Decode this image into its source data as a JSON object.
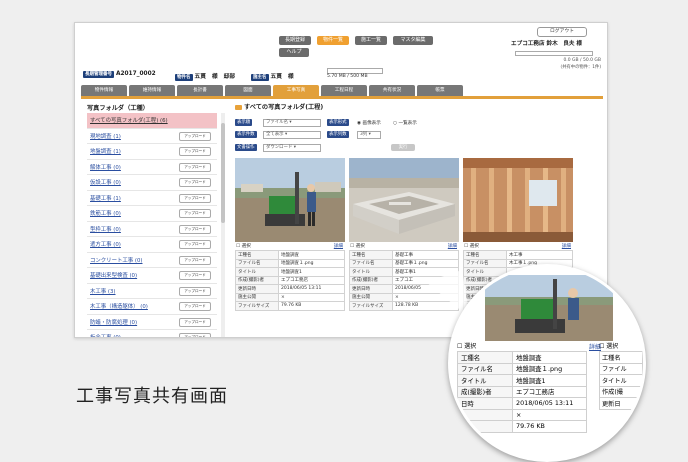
{
  "nav": {
    "buttons": [
      {
        "label": "長期登録"
      },
      {
        "label": "物件一覧"
      },
      {
        "label": "施工一覧"
      },
      {
        "label": "マスタ編集"
      },
      {
        "label": "ヘルプ"
      }
    ]
  },
  "account": {
    "logout_label": "ログアウト",
    "company_user": "エプコ工務店 鈴木　良夫 様",
    "usage": "0.0 GB / 50.0 GB",
    "usage_note": "(共有中の物件：1件)"
  },
  "project": {
    "id_tag": "長期管理番号",
    "id_value": "A2017_0002",
    "name_tag": "物件名",
    "name_value": "五貫　様　邸部",
    "owner_tag": "施主名",
    "owner_value": "五貫　様",
    "storage": "5.70 MB / 500 MB"
  },
  "tabs": [
    {
      "label": "物件情報"
    },
    {
      "label": "維持情報"
    },
    {
      "label": "長計書"
    },
    {
      "label": "図面"
    },
    {
      "label": "工事写真"
    },
    {
      "label": "工程日程"
    },
    {
      "label": "共有状況"
    },
    {
      "label": "帳票"
    }
  ],
  "sidebar": {
    "title": "写真フォルダ（工種）",
    "upload_label": "アップロード",
    "items": [
      {
        "label": "すべての写真フォルダ(工程) (6)"
      },
      {
        "label": "現地調査 (1)"
      },
      {
        "label": "地盤調査 (1)"
      },
      {
        "label": "解体工事 (0)"
      },
      {
        "label": "仮設工事 (0)"
      },
      {
        "label": "基礎工事 (1)"
      },
      {
        "label": "鉄筋工事 (0)"
      },
      {
        "label": "型枠工事 (0)"
      },
      {
        "label": "遣方工事 (0)"
      },
      {
        "label": "コンクリート工事 (0)"
      },
      {
        "label": "基礎出来型検査 (0)"
      },
      {
        "label": "木工事 (3)"
      },
      {
        "label": "木工事（構造躯体） (0)"
      },
      {
        "label": "防蟻・防腐処理 (0)"
      },
      {
        "label": "板金工事 (0)"
      }
    ]
  },
  "main": {
    "title": "すべての写真フォルダ(工程)",
    "display_item_label": "表示順",
    "display_item_value": "ファイル名",
    "display_format_label": "表示形式",
    "radio_image": "画像表示",
    "radio_list": "一覧表示",
    "display_count_label": "表示件数",
    "display_count_value": "全て表示",
    "columns_label": "表示列数",
    "columns_value": "3列",
    "doc_op_label": "文書操作",
    "doc_op_value": "ダウンロード",
    "run_label": "実行",
    "select_label": "選択",
    "detail_label": "詳細"
  },
  "photos": [
    {
      "rows": [
        {
          "k": "工種名",
          "v": "地盤調査"
        },
        {
          "k": "ファイル名",
          "v": "地盤調査１.png"
        },
        {
          "k": "タイトル",
          "v": "地盤調査1"
        },
        {
          "k": "作成(撮影)者",
          "v": "エプコ工務店"
        },
        {
          "k": "更新日時",
          "v": "2018/06/05 13:11"
        },
        {
          "k": "施主公開",
          "v": "×"
        },
        {
          "k": "ファイルサイズ",
          "v": "79.76 KB"
        }
      ]
    },
    {
      "rows": [
        {
          "k": "工種名",
          "v": "基礎工事"
        },
        {
          "k": "ファイル名",
          "v": "基礎工事１.png"
        },
        {
          "k": "タイトル",
          "v": "基礎工事1"
        },
        {
          "k": "作成(撮影)者",
          "v": "エプコ工"
        },
        {
          "k": "更新日時",
          "v": "2018/06/05"
        },
        {
          "k": "施主公開",
          "v": "×"
        },
        {
          "k": "ファイルサイズ",
          "v": "128.78 KB"
        }
      ]
    },
    {
      "rows": [
        {
          "k": "工種名",
          "v": "木工事"
        },
        {
          "k": "ファイル名",
          "v": "木工事１.png"
        },
        {
          "k": "タイトル",
          "v": ""
        },
        {
          "k": "作成(撮影)者",
          "v": ""
        },
        {
          "k": "更新日時",
          "v": ""
        },
        {
          "k": "施主公開",
          "v": ""
        },
        {
          "k": "ファイルサイズ",
          "v": ""
        }
      ]
    }
  ],
  "magnifier": {
    "select_label": "選択",
    "detail_label": "詳細",
    "rows": [
      {
        "k": "工種名",
        "v": "地盤調査"
      },
      {
        "k": "ファイル名",
        "v": "地盤調査１.png"
      },
      {
        "k": "タイトル",
        "v": "地盤調査1"
      },
      {
        "k": "成(撮影)者",
        "v": "エプコ工務店"
      },
      {
        "k": "日時",
        "v": "2018/06/05 13:11"
      },
      {
        "k": "",
        "v": "×"
      },
      {
        "k": "",
        "v": "79.76 KB"
      }
    ],
    "side_rows": [
      {
        "k": "工種名"
      },
      {
        "k": "ファイル"
      },
      {
        "k": "タイトル"
      },
      {
        "k": "作成(撮"
      },
      {
        "k": "更新日"
      }
    ]
  },
  "caption": "工事写真共有画面",
  "colors": {
    "accent_orange": "#e2a03b",
    "navy": "#1d3f7a",
    "selected_pink": "#f3c2c6",
    "link_blue": "#2a4ea0"
  }
}
